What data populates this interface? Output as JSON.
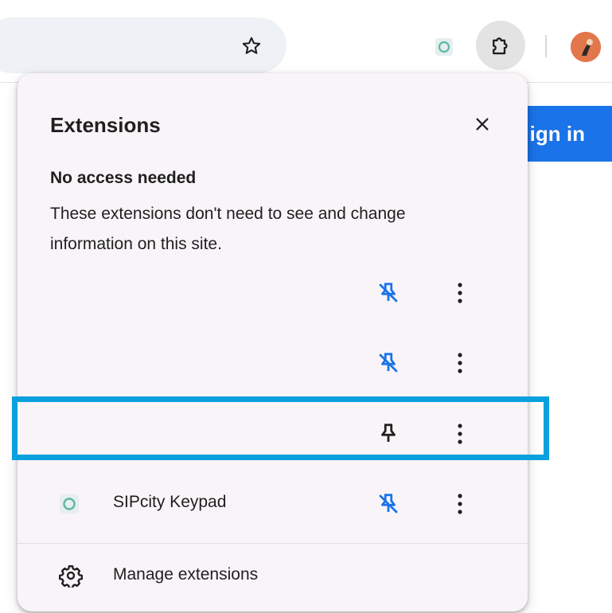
{
  "colors": {
    "accent_blue": "#1a73e8",
    "pin_blue": "#1a73e8",
    "highlight": "#0aa0dd",
    "popup_bg": "#f8f4f8"
  },
  "toolbar": {
    "bookmark_icon": "star-icon",
    "extensions_icon": "puzzle-icon",
    "pinned_extension_icon": "sipcity-keypad-icon",
    "avatar_icon": "profile-avatar"
  },
  "page": {
    "signin_label": "ign in"
  },
  "popup": {
    "title": "Extensions",
    "close_icon": "close-icon",
    "section_title": "No access needed",
    "section_description": "These extensions don't need to see and change information on this site.",
    "extensions": [
      {
        "name": "",
        "pinned": true
      },
      {
        "name": "",
        "pinned": true
      },
      {
        "name": "",
        "pinned": false
      },
      {
        "name": "SIPcity Keypad",
        "pinned": true
      }
    ],
    "manage_label": "Manage extensions"
  }
}
